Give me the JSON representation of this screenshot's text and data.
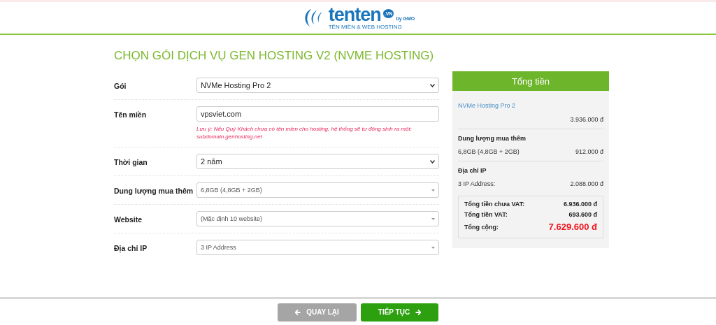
{
  "logo": {
    "name": "tenten",
    "tld": ".VN",
    "by": "by GMO",
    "tagline": "TÊN MIỀN & WEB HOSTING"
  },
  "title": "CHỌN GÓI DỊCH VỤ GEN HOSTING V2 (NVME HOSTING)",
  "form": [
    {
      "label": "Gói",
      "kind": "select",
      "value": "NVMe Hosting Pro 2"
    },
    {
      "label": "Tên miền",
      "kind": "input",
      "value": "vpsviet.com",
      "note": "Lưu ý: Nếu Quý Khách chưa có tên miền cho hosting, hệ thống sẽ tự động sinh ra một: subdomain.genhosting.net"
    },
    {
      "label": "Thời gian",
      "kind": "select",
      "value": "2 năm"
    },
    {
      "label": "Dung lượng mua thêm",
      "kind": "combo",
      "value": "6,8GB (4,8GB + 2GB)"
    },
    {
      "label": "Website",
      "kind": "combo",
      "value": "(Mặc định 10 website)"
    },
    {
      "label": "Địa chỉ IP",
      "kind": "combo",
      "value": "3 IP Address"
    }
  ],
  "summary": {
    "heading": "Tổng tiền",
    "package": "NVMe Hosting Pro 2",
    "package_price": "3.936.000 đ",
    "sections": [
      {
        "title": "Dung lượng mua thêm",
        "item": "6,8GB (4,8GB + 2GB)",
        "price": "912.000 đ"
      },
      {
        "title": "Địa chỉ IP",
        "item": "3 IP Address:",
        "price": "2.088.000 đ"
      }
    ],
    "totals": [
      {
        "label": "Tổng tiền chưa VAT:",
        "value": "6.936.000 đ",
        "kind": "normal"
      },
      {
        "label": "Tổng tiền VAT:",
        "value": "693.600 đ",
        "kind": "normal"
      },
      {
        "label": "Tổng cộng:",
        "value": "7.629.600 đ",
        "kind": "grand"
      }
    ]
  },
  "buttons": [
    {
      "label": "QUAY LẠI",
      "kind": "back"
    },
    {
      "label": "TIẾP TỤC",
      "kind": "next"
    }
  ]
}
